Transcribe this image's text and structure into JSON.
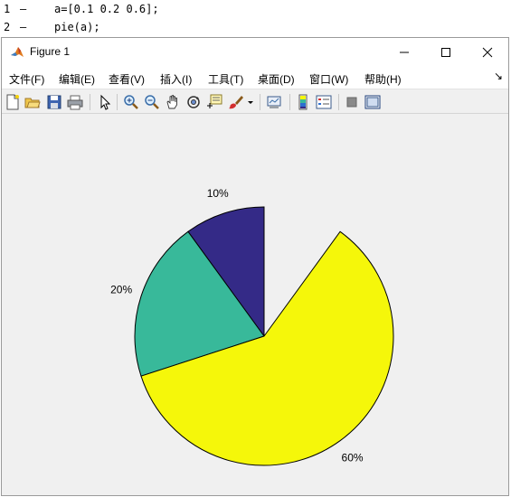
{
  "editor": {
    "lines": [
      {
        "number": "1",
        "marker": "–",
        "code": "a=[0.1 0.2 0.6];"
      },
      {
        "number": "2",
        "marker": "–",
        "code": "pie(a);"
      }
    ]
  },
  "window": {
    "title": "Figure 1",
    "icon": "matlab-logo-icon"
  },
  "menu": {
    "items": [
      "文件(F)",
      "编辑(E)",
      "查看(V)",
      "插入(I)",
      "工具(T)",
      "桌面(D)",
      "窗口(W)",
      "帮助(H)"
    ],
    "overflow_arrow": "↘"
  },
  "toolbar": {
    "icons": [
      "new-figure-icon",
      "open-icon",
      "save-icon",
      "print-icon",
      "pointer-icon",
      "zoom-in-icon",
      "zoom-out-icon",
      "pan-icon",
      "rotate-3d-icon",
      "data-cursor-icon",
      "brush-icon",
      "brush-dropdown-icon",
      "link-plot-icon",
      "colorbar-icon",
      "legend-icon",
      "hide-plot-tools-icon",
      "show-plot-tools-icon"
    ]
  },
  "chart_data": {
    "type": "pie",
    "values": [
      0.1,
      0.2,
      0.6
    ],
    "labels": [
      "10%",
      "20%",
      "60%"
    ],
    "colors": [
      "#342a87",
      "#38b99a",
      "#f5f70a"
    ],
    "start": "12 o'clock",
    "direction": "counterclockwise",
    "partial": true
  }
}
